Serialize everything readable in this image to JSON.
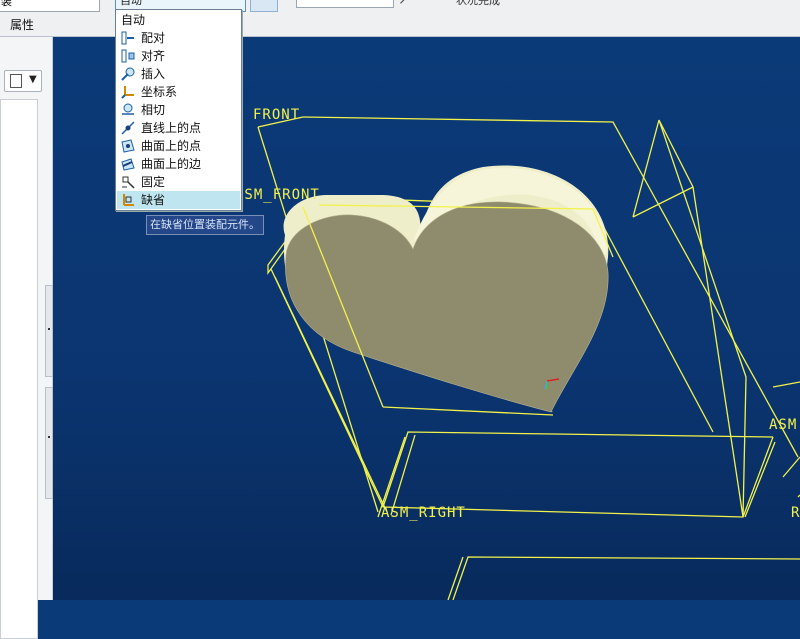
{
  "toolbar": {
    "left_field_value": "装",
    "properties_label": "属性",
    "type_combo_value": "自动",
    "right_status": "状况完成"
  },
  "constraint_menu": {
    "items": [
      {
        "label": "自动",
        "icon": null
      },
      {
        "label": "配对",
        "icon": "mate-icon"
      },
      {
        "label": "对齐",
        "icon": "align-icon"
      },
      {
        "label": "插入",
        "icon": "insert-icon"
      },
      {
        "label": "坐标系",
        "icon": "coordinate-system-icon"
      },
      {
        "label": "相切",
        "icon": "tangent-icon"
      },
      {
        "label": "直线上的点",
        "icon": "point-on-line-icon"
      },
      {
        "label": "曲面上的点",
        "icon": "point-on-surface-icon"
      },
      {
        "label": "曲面上的边",
        "icon": "edge-on-surface-icon"
      },
      {
        "label": "固定",
        "icon": "fix-icon"
      },
      {
        "label": "缺省",
        "icon": "default-icon"
      }
    ],
    "selected": "缺省",
    "tooltip": "在缺省位置装配元件。"
  },
  "viewport": {
    "datum_labels": {
      "front": "FRONT",
      "asm_front": "ASM_FRONT",
      "asm_right": "ASM_RIGHT",
      "asm_top": "ASM",
      "right_edge": "R"
    },
    "colors": {
      "background": "#0b3a78",
      "datum": "#f2f24a",
      "part_face": "#8f8c6e",
      "part_side": "#efeeca"
    }
  }
}
